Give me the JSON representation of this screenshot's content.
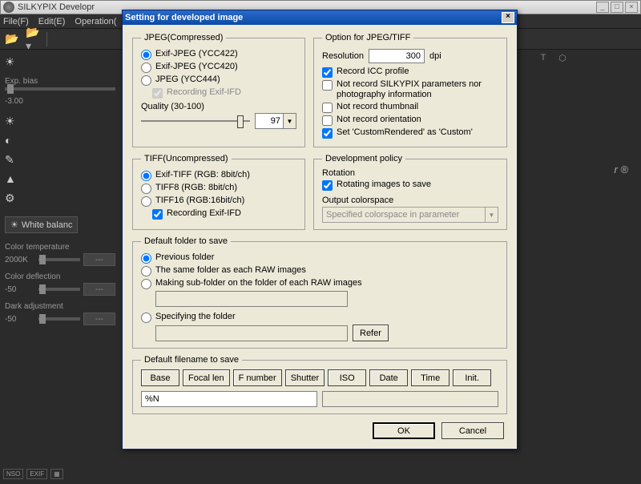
{
  "app": {
    "title": "SILKYPIX Developr",
    "menu": {
      "file": "File(F)",
      "edit": "Edit(E)",
      "operation": "Operation("
    },
    "left": {
      "exp_bias_label": "Exp. bias",
      "exp_bias_value": "-3.00",
      "wb_tab": "White balanc",
      "color_temp_label": "Color temperature",
      "color_temp_value": "2000K",
      "color_temp_dash": "---",
      "color_defl_label": "Color deflection",
      "color_defl_value": "-50",
      "color_defl_dash": "---",
      "dark_adj_label": "Dark adjustment",
      "dark_adj_value": "-50",
      "dark_adj_dash": "---"
    },
    "bottom": {
      "nso": "NSO",
      "exif": "EXIF"
    }
  },
  "dialog": {
    "title": "Setting for developed image",
    "jpeg": {
      "legend": "JPEG(Compressed)",
      "opt1": "Exif-JPEG  (YCC422)",
      "opt2": "Exif-JPEG  (YCC420)",
      "opt3": "JPEG  (YCC444)",
      "rec_exif": "Recording Exif-IFD",
      "quality_label": "Quality (30-100)",
      "quality_value": "97"
    },
    "option": {
      "legend": "Option for JPEG/TIFF",
      "res_label": "Resolution",
      "res_value": "300",
      "res_unit": "dpi",
      "icc": "Record ICC profile",
      "noparam": "Not record SILKYPIX parameters nor photography information",
      "nothumb": "Not record thumbnail",
      "noorient": "Not record orientation",
      "custom": "Set 'CustomRendered' as 'Custom'"
    },
    "tiff": {
      "legend": "TIFF(Uncompressed)",
      "opt1": "Exif-TIFF  (RGB: 8bit/ch)",
      "opt2": "TIFF8   (RGB: 8bit/ch)",
      "opt3": "TIFF16  (RGB:16bit/ch)",
      "rec_exif": "Recording Exif-IFD"
    },
    "policy": {
      "legend": "Development policy",
      "rot_label": "Rotation",
      "rot_check": "Rotating images to save",
      "out_label": "Output colorspace",
      "out_value": "Specified colorspace in parameter"
    },
    "folder": {
      "legend": "Default folder to save",
      "prev": "Previous folder",
      "same": "The same folder as each RAW images",
      "sub": "Making sub-folder on the folder of each RAW images",
      "spec": "Specifying the folder",
      "refer": "Refer"
    },
    "filename": {
      "legend": "Default filename to save",
      "b1": "Base",
      "b2": "Focal len",
      "b3": "F number",
      "b4": "Shutter",
      "b5": "ISO",
      "b6": "Date",
      "b7": "Time",
      "b8": "Init.",
      "value": "%N"
    },
    "ok": "OK",
    "cancel": "Cancel"
  }
}
